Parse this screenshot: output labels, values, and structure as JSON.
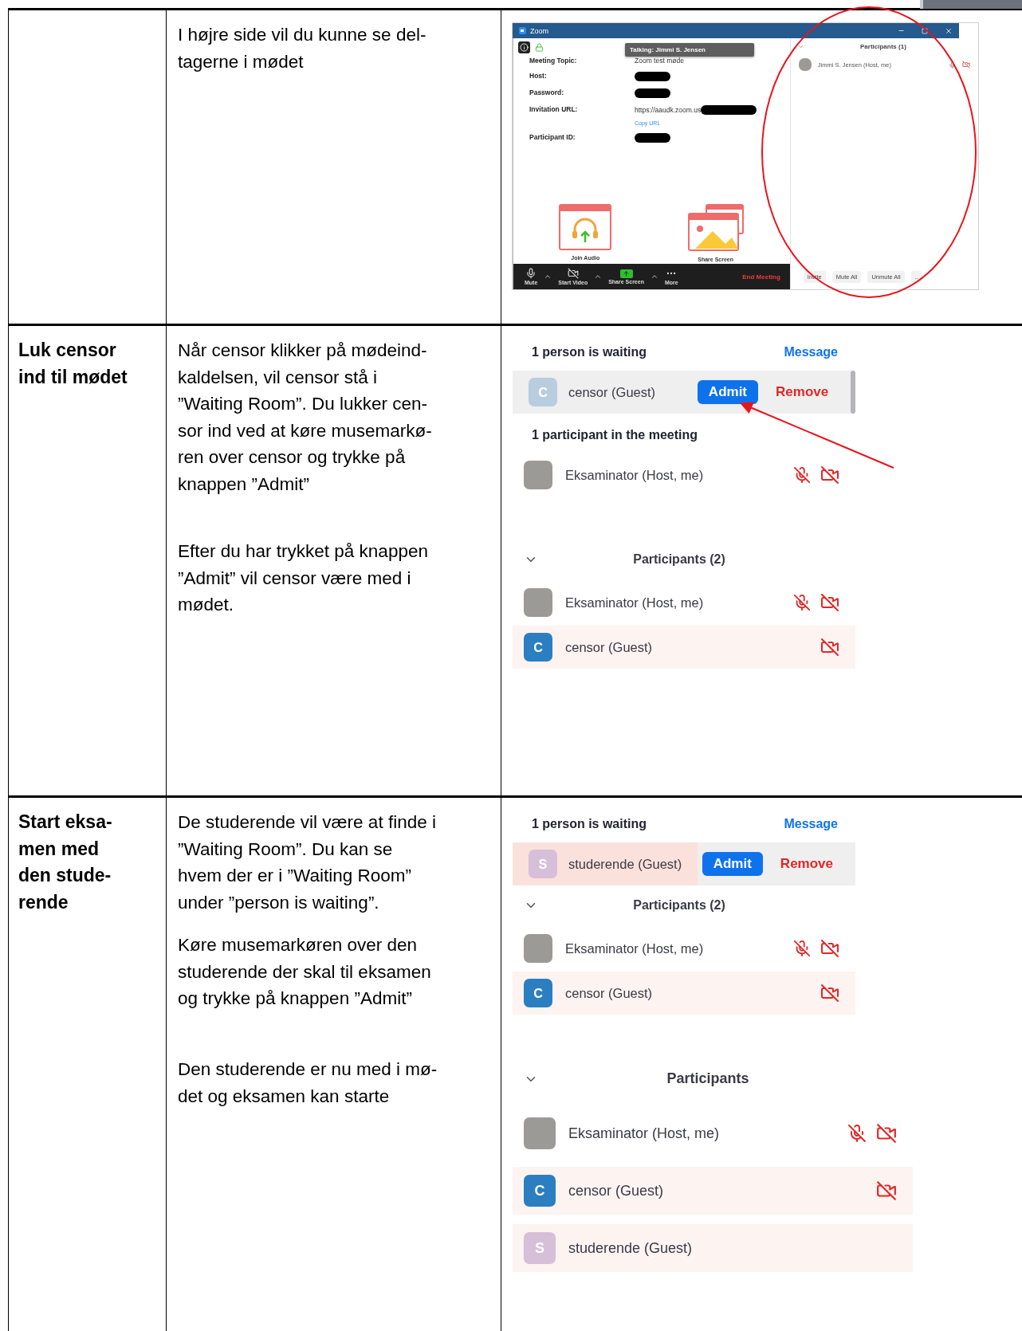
{
  "rows": [
    {
      "steps": [
        {
          "paragraphs": [
            {
              "lines": [
                "I højre side vil du kunne se del-",
                "tagerne i mødet"
              ]
            }
          ],
          "panel": {
            "kind": "zoom_window",
            "title": "Zoom",
            "tooltip": "Talking: Jimmi S. Jensen",
            "circled": true,
            "fields": [
              {
                "label": "Meeting Topic:",
                "value": "Zoom test møde",
                "redacted": false
              },
              {
                "label": "Host:",
                "redacted": true
              },
              {
                "label": "Password:",
                "redacted": true
              },
              {
                "label": "Invitation URL:",
                "value": "https://aaudk.zoom.us",
                "redacted": true,
                "link": "Copy URL"
              },
              {
                "label": "Participant ID:",
                "redacted": true
              }
            ],
            "tiles": [
              {
                "kind": "audio",
                "label": "Join Audio"
              },
              {
                "kind": "share",
                "label": "Share Screen"
              }
            ],
            "toolbar": [
              {
                "kind": "mic",
                "label": "Mute",
                "menu": true
              },
              {
                "kind": "camera",
                "label": "Start Video",
                "menu": true
              },
              {
                "kind": "share",
                "label": "Share Screen",
                "menu": true
              },
              {
                "kind": "more",
                "label": "More",
                "menu": false
              }
            ],
            "end_button": "End Meeting",
            "side": {
              "title": "Participants (1)",
              "participants": [
                {
                  "name": "Jimmi S. Jensen (Host, me)",
                  "mic_muted": false,
                  "video_off": true,
                  "highlighted": false
                }
              ],
              "buttons": [
                "Invite",
                "Mute All",
                "Unmute All",
                ".."
              ]
            }
          }
        }
      ]
    },
    {
      "heading": {
        "lines": [
          "Luk censor",
          "ind til mødet"
        ]
      },
      "steps": [
        {
          "paragraphs": [
            {
              "lines": [
                "Når censor klikker på mødeind-",
                "kaldelsen, vil censor stå i",
                "”Waiting Room”. Du lukker cen-",
                "sor ind ved at køre musemarkø-",
                "ren over censor og trykke på",
                "knappen ”Admit”"
              ]
            }
          ],
          "panel": {
            "kind": "list",
            "pointer_arrow": true,
            "items": [
              {
                "kind": "waiting_header",
                "text": "1 person is waiting",
                "action": "Message"
              },
              {
                "kind": "waiting",
                "initial": "C",
                "color": "#b9cde0",
                "name": "censor (Guest)",
                "admit": "Admit",
                "remove": "Remove",
                "highlighted": false,
                "scrollbar": true
              },
              {
                "kind": "heading",
                "text": "1 participant in the meeting"
              },
              {
                "kind": "participant",
                "name": "Eksaminator (Host, me)",
                "mic_muted": true,
                "video_off": true,
                "highlighted": false
              }
            ]
          }
        },
        {
          "paragraphs": [
            {
              "lines": [
                "Efter du har trykket på knappen",
                "”Admit” vil censor være med i",
                "mødet."
              ]
            }
          ],
          "panel": {
            "kind": "list",
            "items": [
              {
                "kind": "collapsible_heading",
                "text": "Participants (2)"
              },
              {
                "kind": "participant",
                "name": "Eksaminator (Host, me)",
                "mic_muted": true,
                "video_off": true,
                "highlighted": false
              },
              {
                "kind": "participant",
                "initial": "C",
                "color": "#2b7fc0",
                "name": "censor (Guest)",
                "video_off": true,
                "highlighted": true
              }
            ]
          }
        }
      ]
    },
    {
      "heading": {
        "lines": [
          "Start eksa-",
          "men med",
          "den stude-",
          "rende"
        ]
      },
      "steps": [
        {
          "paragraphs": [
            {
              "lines": [
                "De studerende vil være at finde i",
                "”Waiting Room”. Du kan se",
                "hvem der er i ”Waiting Room”",
                "under ”person is waiting”."
              ]
            },
            {
              "lines": [
                "Køre musemarkøren over den",
                "studerende der skal til eksamen",
                "og trykke på knappen ”Admit”"
              ]
            }
          ],
          "panel": {
            "kind": "list",
            "items": [
              {
                "kind": "waiting_header",
                "text": "1 person is waiting",
                "action": "Message"
              },
              {
                "kind": "waiting",
                "initial": "S",
                "color": "#d7bfd9",
                "name": "studerende (Guest)",
                "admit": "Admit",
                "remove": "Remove",
                "highlighted": true,
                "scrollbar": false
              },
              {
                "kind": "collapsible_heading",
                "text": "Participants (2)"
              },
              {
                "kind": "participant",
                "name": "Eksaminator (Host, me)",
                "mic_muted": true,
                "video_off": true,
                "highlighted": false
              },
              {
                "kind": "participant",
                "initial": "C",
                "color": "#2b7fc0",
                "name": "censor (Guest)",
                "video_off": true,
                "highlighted": true
              }
            ]
          }
        },
        {
          "paragraphs": [
            {
              "lines": [
                "Den studerende er nu med i mø-",
                "det og eksamen kan starte"
              ]
            }
          ],
          "panel": {
            "kind": "list",
            "large": true,
            "items": [
              {
                "kind": "collapsible_heading",
                "text": "Participants"
              },
              {
                "kind": "participant",
                "name": "Eksaminator (Host, me)",
                "mic_muted": true,
                "video_off": true,
                "highlighted": false
              },
              {
                "kind": "participant",
                "initial": "C",
                "color": "#2b7fc0",
                "name": "censor (Guest)",
                "video_off": true,
                "highlighted": true
              },
              {
                "kind": "participant",
                "initial": "S",
                "color": "#d7bfd9",
                "name": "studerende (Guest)",
                "highlighted": true
              }
            ]
          }
        }
      ]
    }
  ]
}
